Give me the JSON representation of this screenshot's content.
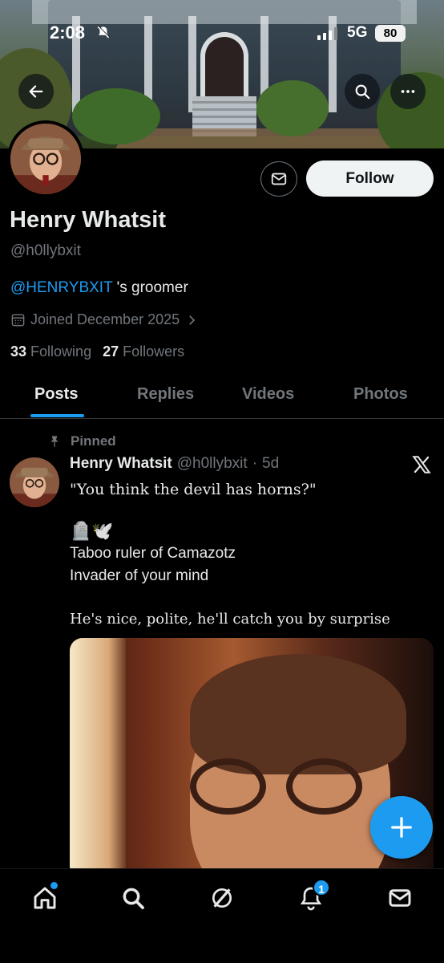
{
  "status_bar": {
    "time": "2:08",
    "network": "5G",
    "battery": "80"
  },
  "profile": {
    "name": "Henry Whatsit",
    "handle": "@h0llybxit",
    "bio_mention": "@HENRYBXIT",
    "bio_rest": " 's groomer",
    "joined": "Joined December 2025",
    "following_count": "33",
    "following_label": "Following",
    "followers_count": "27",
    "followers_label": "Followers",
    "follow_label": "Follow"
  },
  "tabs": [
    {
      "label": "Posts",
      "active": true
    },
    {
      "label": "Replies",
      "active": false
    },
    {
      "label": "Videos",
      "active": false
    },
    {
      "label": "Photos",
      "active": false
    }
  ],
  "post": {
    "pinned_label": "Pinned",
    "author_name": "Henry Whatsit",
    "author_handle": "@h0llybxit",
    "separator": "·",
    "age": "5d",
    "line1": "\"You think the devil has horns?\"",
    "emoji_line": "🪦🕊️",
    "line2": "Taboo ruler of Camazotz",
    "line3": "Invader of your mind",
    "line4": "He's nice, polite, he'll catch you by surprise"
  },
  "bottom_nav": {
    "notifications_badge": "1"
  },
  "colors": {
    "accent": "#1d9bf0",
    "background": "#000000",
    "text_primary": "#e7e9ea",
    "text_secondary": "#71767b"
  },
  "icons": [
    "back-arrow-icon",
    "search-icon",
    "more-icon",
    "mail-icon",
    "calendar-icon",
    "chevron-right-icon",
    "pin-icon",
    "x-logo-icon",
    "plus-icon",
    "home-icon",
    "explore-icon",
    "grok-icon",
    "bell-icon",
    "messages-icon"
  ]
}
